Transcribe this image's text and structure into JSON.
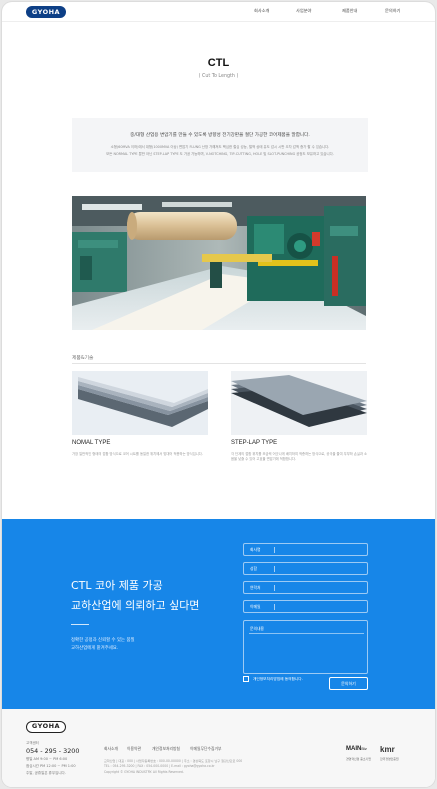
{
  "header": {
    "logo": "GYOHA",
    "nav": [
      "회사소개",
      "사업분야",
      "제품안내",
      "문의하기"
    ]
  },
  "page": {
    "title": "CTL",
    "subtitle": "( Cut To Length )"
  },
  "intro": {
    "headline": "중/대형 산업용 변압기를 만들 수 있도록 방향성 전기강판을 절단 가공한 코어제품을 말합니다.",
    "lines": [
      "소형(60MVA 이하)에서 대형(1000MVA 이상) 변압기 FLUNG 난방 가해져도 핵심한 철심 성능, 철액 상태 유도 감시 시판 오차 감액 증가 할 수 있습니다.",
      "모든 NORMAL TYPE 뿐만 아닌 STEP-LAP TYPE 도 가공 가능하며, V-NOTCHING, TIP-CUTTING, HOLE 및 SLOT-PUNCHING 공정도 보유하고 있습니다."
    ]
  },
  "products": {
    "section_label": "제품&기술",
    "items": [
      {
        "title": "NOMAL TYPE",
        "desc": "가장 일반적인 형태의 접합 방식으로 코어 시트를 동일한 위치에서 맞대어 적층하는 방식입니다."
      },
      {
        "title": "STEP-LAP TYPE",
        "desc": "각 단계의 접합 위치를 조금씩 어긋나게 배치하여 적층하는 방식으로, 공극을 줄여 무부하 손실과 소음을 낮출 수 있어 고효율 변압기에 적합합니다."
      }
    ]
  },
  "contact": {
    "heading_line1": "CTL 코아 제품 가공",
    "heading_line2": "교하산업에 의뢰하고 싶다면",
    "text_line1": "정확한 공정과 신뢰할 수 있는 품질",
    "text_line2": "교하산업에게 맡겨주세요.",
    "fields": [
      "회사명",
      "성함",
      "연락처",
      "이메일"
    ],
    "message_label": "문의내용",
    "agree_label": "개인정보처리방침에 동의합니다.",
    "submit_label": "문의하기"
  },
  "footer": {
    "logo": "GYOHA",
    "cs_label": "고객센터",
    "phone": "054 - 295 - 3200",
    "hours": [
      "평일 AM 9:00 ~ PM 6:00",
      "점심시간 PM 12:00 ~ PM 1:00",
      "주말, 공휴일은 휴무입니다."
    ],
    "links": [
      "회사소개",
      "이용약관",
      "개인정보처리방침",
      "이메일무단수집거부"
    ],
    "info_lines": [
      "교하산업  |  대표 : 000  |  사업자등록번호 : 000-00-00000  |  주소 : 경상북도 포항시 남구 철강산단로 000",
      "TEL : 054-295-3200  |  FAX : 054-000-0000  |  E-mail : gyoha@gyoha.co.kr",
      "Copyright © GYOHA INDUSTRY. All Rights Reserved."
    ],
    "badge_mainbiz": "MAIN",
    "badge_mainbiz_suffix": "Biz",
    "badge_mainbiz_cap": "경영혁신형 중소기업",
    "badge_kmr": "kmr",
    "badge_kmr_cap": "한국경영인증원"
  },
  "colors": {
    "brand_navy": "#0d3f86",
    "contact_blue": "#1786e8"
  }
}
